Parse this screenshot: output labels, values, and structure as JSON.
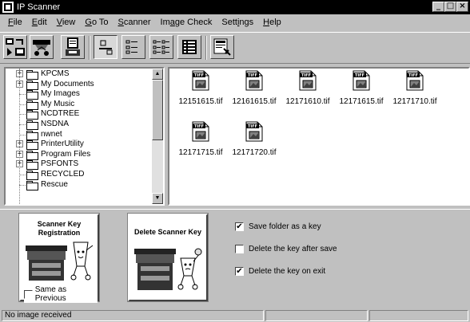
{
  "window": {
    "title": "IP Scanner"
  },
  "menu": [
    {
      "label": "File",
      "hotkey": "F"
    },
    {
      "label": "Edit",
      "hotkey": "E"
    },
    {
      "label": "View",
      "hotkey": "V"
    },
    {
      "label": "Go To",
      "hotkey": "G"
    },
    {
      "label": "Scanner",
      "hotkey": "S"
    },
    {
      "label": "Image Check",
      "hotkey": "a"
    },
    {
      "label": "Settings",
      "hotkey": "i"
    },
    {
      "label": "Help",
      "hotkey": "H"
    }
  ],
  "toolbar": {
    "icons": [
      "scan-settings-icon",
      "scanner-network-icon",
      "ip-scanner-icon",
      "large-icons-view-icon",
      "small-icons-view-icon",
      "list-view-icon",
      "details-view-icon",
      "settings-icon"
    ],
    "pressed_view": "large-icons-view-icon"
  },
  "tree": {
    "items": [
      {
        "label": "KPCMS",
        "expandable": true
      },
      {
        "label": "My Documents",
        "expandable": true
      },
      {
        "label": "My Images",
        "expandable": false
      },
      {
        "label": "My Music",
        "expandable": false
      },
      {
        "label": "NCDTREE",
        "expandable": false
      },
      {
        "label": "NSDNA",
        "expandable": false
      },
      {
        "label": "nwnet",
        "expandable": false
      },
      {
        "label": "PrinterUtility",
        "expandable": true
      },
      {
        "label": "Program Files",
        "expandable": true
      },
      {
        "label": "PSFONTS",
        "expandable": true
      },
      {
        "label": "RECYCLED",
        "expandable": false
      },
      {
        "label": "Rescue",
        "expandable": false
      }
    ]
  },
  "files": {
    "type_badge": "TIFF",
    "items": [
      "12151615.tif",
      "12161615.tif",
      "12171610.tif",
      "12171615.tif",
      "12171710.tif",
      "12171715.tif",
      "12171720.tif"
    ]
  },
  "scanner_key": {
    "registration_label": "Scanner Key Registration",
    "same_as_previous_label": "Same as Previous",
    "same_as_previous_checked": false,
    "delete_label": "Delete Scanner Key"
  },
  "options": [
    {
      "label": "Save folder as a key",
      "checked": true
    },
    {
      "label": "Delete the key after save",
      "checked": false
    },
    {
      "label": "Delete the key on exit",
      "checked": true
    }
  ],
  "status": {
    "message": "No image received"
  }
}
